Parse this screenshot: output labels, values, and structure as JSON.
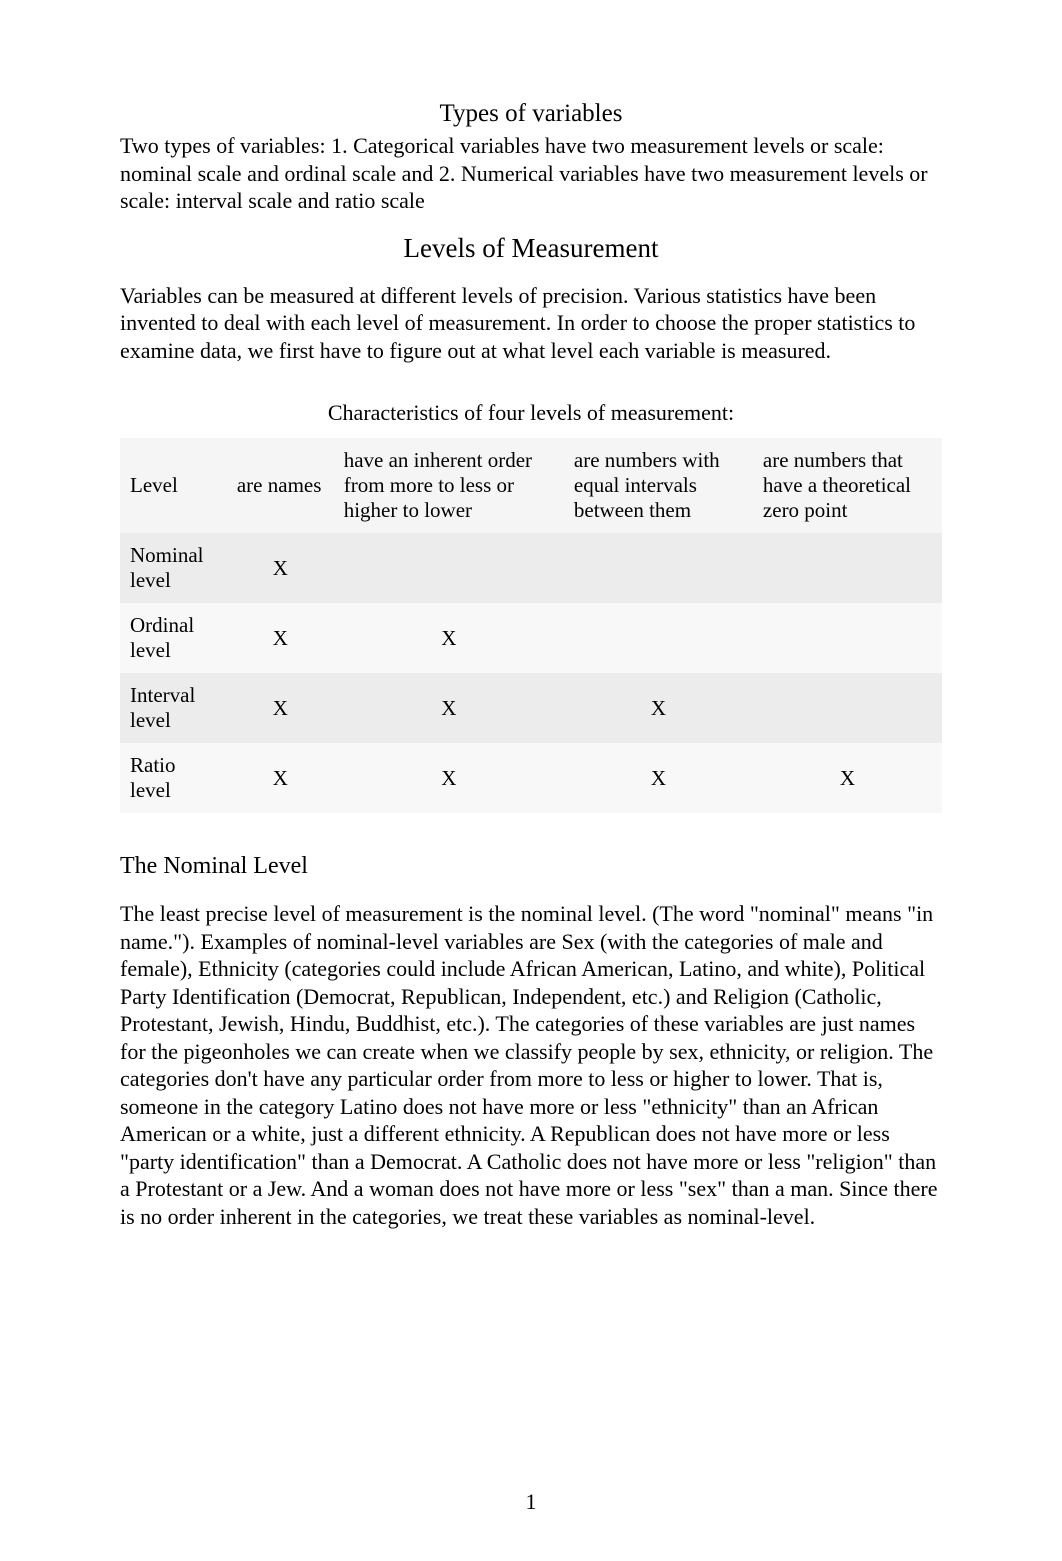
{
  "titles": {
    "types": "Types of variables",
    "levels": "Levels of Measurement",
    "table_caption": "Characteristics of four levels of measurement:",
    "nominal_heading": "The Nominal Level"
  },
  "paragraphs": {
    "types_intro": "Two types of variables: 1. Categorical  variables have two measurement levels or scale: nominal scale and ordinal scale and 2. Numerical  variables have two measurement levels or scale: interval scale and ratio scale",
    "levels_intro": "Variables can be measured at different levels of precision. Various statistics have been invented to deal with each level of measurement. In order to choose the proper statistics to examine data, we first have to figure out at what level each variable is measured.",
    "nominal_body": "The least precise level of measurement is the nominal level. (The word \"nominal\" means \"in name.\"). Examples of nominal-level variables are Sex (with the categories of male and female), Ethnicity (categories could include African American, Latino, and white), Political Party Identification (Democrat, Republican, Independent, etc.) and Religion (Catholic, Protestant, Jewish, Hindu, Buddhist, etc.). The categories of these variables are just names for the pigeonholes we can create when we classify people by sex, ethnicity, or religion. The categories don't have any particular order from more to less or higher to lower. That is, someone in the category Latino does not have more or less \"ethnicity\" than an African American or a white, just a different ethnicity. A Republican does not have more or less \"party identification\" than a Democrat. A Catholic does not have more or less \"religion\" than a Protestant or a Jew. And a woman does not have more or less \"sex\" than a man. Since there is no order inherent in the categories, we treat these variables as nominal-level."
  },
  "table": {
    "headers": {
      "level": "Level",
      "names": "are names",
      "order": "have an inherent order from more to less or higher to lower",
      "intervals": "are numbers with equal intervals between them",
      "zero": "are numbers that have a theoretical zero point"
    },
    "rows": [
      {
        "label": "Nominal level",
        "names": "X",
        "order": "",
        "intervals": "",
        "zero": ""
      },
      {
        "label": "Ordinal level",
        "names": "X",
        "order": "X",
        "intervals": "",
        "zero": ""
      },
      {
        "label": "Interval level",
        "names": "X",
        "order": "X",
        "intervals": "X",
        "zero": ""
      },
      {
        "label": "Ratio level",
        "names": "X",
        "order": "X",
        "intervals": "X",
        "zero": "X"
      }
    ]
  },
  "page_number": "1"
}
